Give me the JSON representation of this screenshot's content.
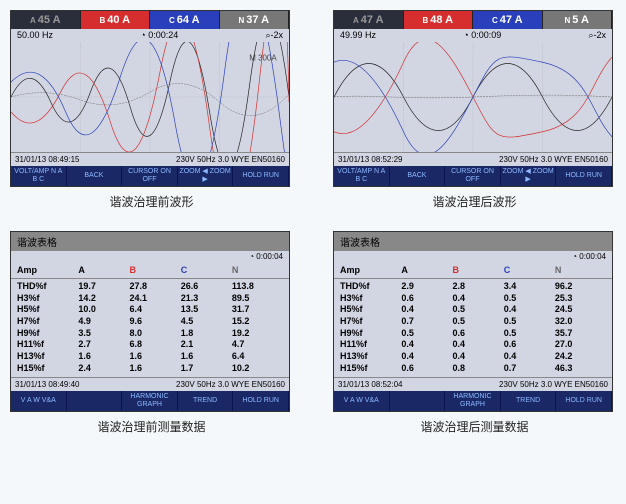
{
  "before_wave": {
    "header": {
      "a": "45 A",
      "b": "40 A",
      "c": "64 A",
      "n": "37 A"
    },
    "sub": {
      "freq": "50.00 Hz",
      "time": "0:00:24",
      "zoom": "⌕-2x"
    },
    "marker": "M 300A",
    "footer": {
      "date": "31/01/13  08:49:15",
      "info": "230V  50Hz 3.0 WYE    EN50160"
    },
    "menu": [
      "VOLT/AMP\nN A B C",
      "BACK",
      "CURSOR\nON OFF",
      "ZOOM ◀\nZOOM ▶",
      "HOLD\nRUN"
    ]
  },
  "after_wave": {
    "header": {
      "a": "47 A",
      "b": "48 A",
      "c": "47 A",
      "n": "5 A"
    },
    "sub": {
      "freq": "49.99 Hz",
      "time": "0:00:09",
      "zoom": "⌕-2x"
    },
    "footer": {
      "date": "31/01/13  08:52:29",
      "info": "230V  50Hz 3.0 WYE    EN50160"
    },
    "menu": [
      "VOLT/AMP\nN A B C",
      "BACK",
      "CURSOR\nON OFF",
      "ZOOM ◀\nZOOM ▶",
      "HOLD\nRUN"
    ]
  },
  "captions": {
    "wave_before": "谐波治理前波形",
    "wave_after": "谐波治理后波形",
    "data_before": "谐波治理前测量数据",
    "data_after": "谐波治理后测量数据"
  },
  "table_title": "谐波表格",
  "table_cols": {
    "amp": "Amp",
    "a": "A",
    "b": "B",
    "c": "C",
    "n": "N"
  },
  "chart_data": [
    {
      "type": "table",
      "title": "谐波治理前测量数据",
      "clock": "0:00:04",
      "rows": [
        {
          "lbl": "THD%f",
          "a": "19.7",
          "b": "27.8",
          "c": "26.6",
          "n": "113.8"
        },
        {
          "lbl": "H3%f",
          "a": "14.2",
          "b": "24.1",
          "c": "21.3",
          "n": "89.5"
        },
        {
          "lbl": "H5%f",
          "a": "10.0",
          "b": "6.4",
          "c": "13.5",
          "n": "31.7"
        },
        {
          "lbl": "H7%f",
          "a": "4.9",
          "b": "9.6",
          "c": "4.5",
          "n": "15.2"
        },
        {
          "lbl": "H9%f",
          "a": "3.5",
          "b": "8.0",
          "c": "1.8",
          "n": "19.2"
        },
        {
          "lbl": "H11%f",
          "a": "2.7",
          "b": "6.8",
          "c": "2.1",
          "n": "4.7"
        },
        {
          "lbl": "H13%f",
          "a": "1.6",
          "b": "1.6",
          "c": "1.6",
          "n": "6.4"
        },
        {
          "lbl": "H15%f",
          "a": "2.4",
          "b": "1.6",
          "c": "1.7",
          "n": "10.2"
        }
      ],
      "footer": {
        "date": "31/01/13  08:49:40",
        "info": "230V  50Hz 3.0 WYE    EN50160"
      },
      "menu": [
        "V A W\nV&A",
        "",
        "HARMONIC\nGRAPH",
        "TREND",
        "HOLD\nRUN"
      ]
    },
    {
      "type": "table",
      "title": "谐波治理后测量数据",
      "clock": "0:00:04",
      "rows": [
        {
          "lbl": "THD%f",
          "a": "2.9",
          "b": "2.8",
          "c": "3.4",
          "n": "96.2"
        },
        {
          "lbl": "H3%f",
          "a": "0.6",
          "b": "0.4",
          "c": "0.5",
          "n": "25.3"
        },
        {
          "lbl": "H5%f",
          "a": "0.4",
          "b": "0.5",
          "c": "0.4",
          "n": "24.5"
        },
        {
          "lbl": "H7%f",
          "a": "0.7",
          "b": "0.5",
          "c": "0.5",
          "n": "32.0"
        },
        {
          "lbl": "H9%f",
          "a": "0.5",
          "b": "0.6",
          "c": "0.5",
          "n": "35.7"
        },
        {
          "lbl": "H11%f",
          "a": "0.4",
          "b": "0.4",
          "c": "0.6",
          "n": "27.0"
        },
        {
          "lbl": "H13%f",
          "a": "0.4",
          "b": "0.4",
          "c": "0.4",
          "n": "24.2"
        },
        {
          "lbl": "H15%f",
          "a": "0.6",
          "b": "0.8",
          "c": "0.7",
          "n": "46.3"
        }
      ],
      "footer": {
        "date": "31/01/13  08:52:04",
        "info": "230V  50Hz 3.0 WYE    EN50160"
      },
      "menu": [
        "V A W\nV&A",
        "",
        "HARMONIC\nGRAPH",
        "TREND",
        "HOLD\nRUN"
      ]
    }
  ]
}
